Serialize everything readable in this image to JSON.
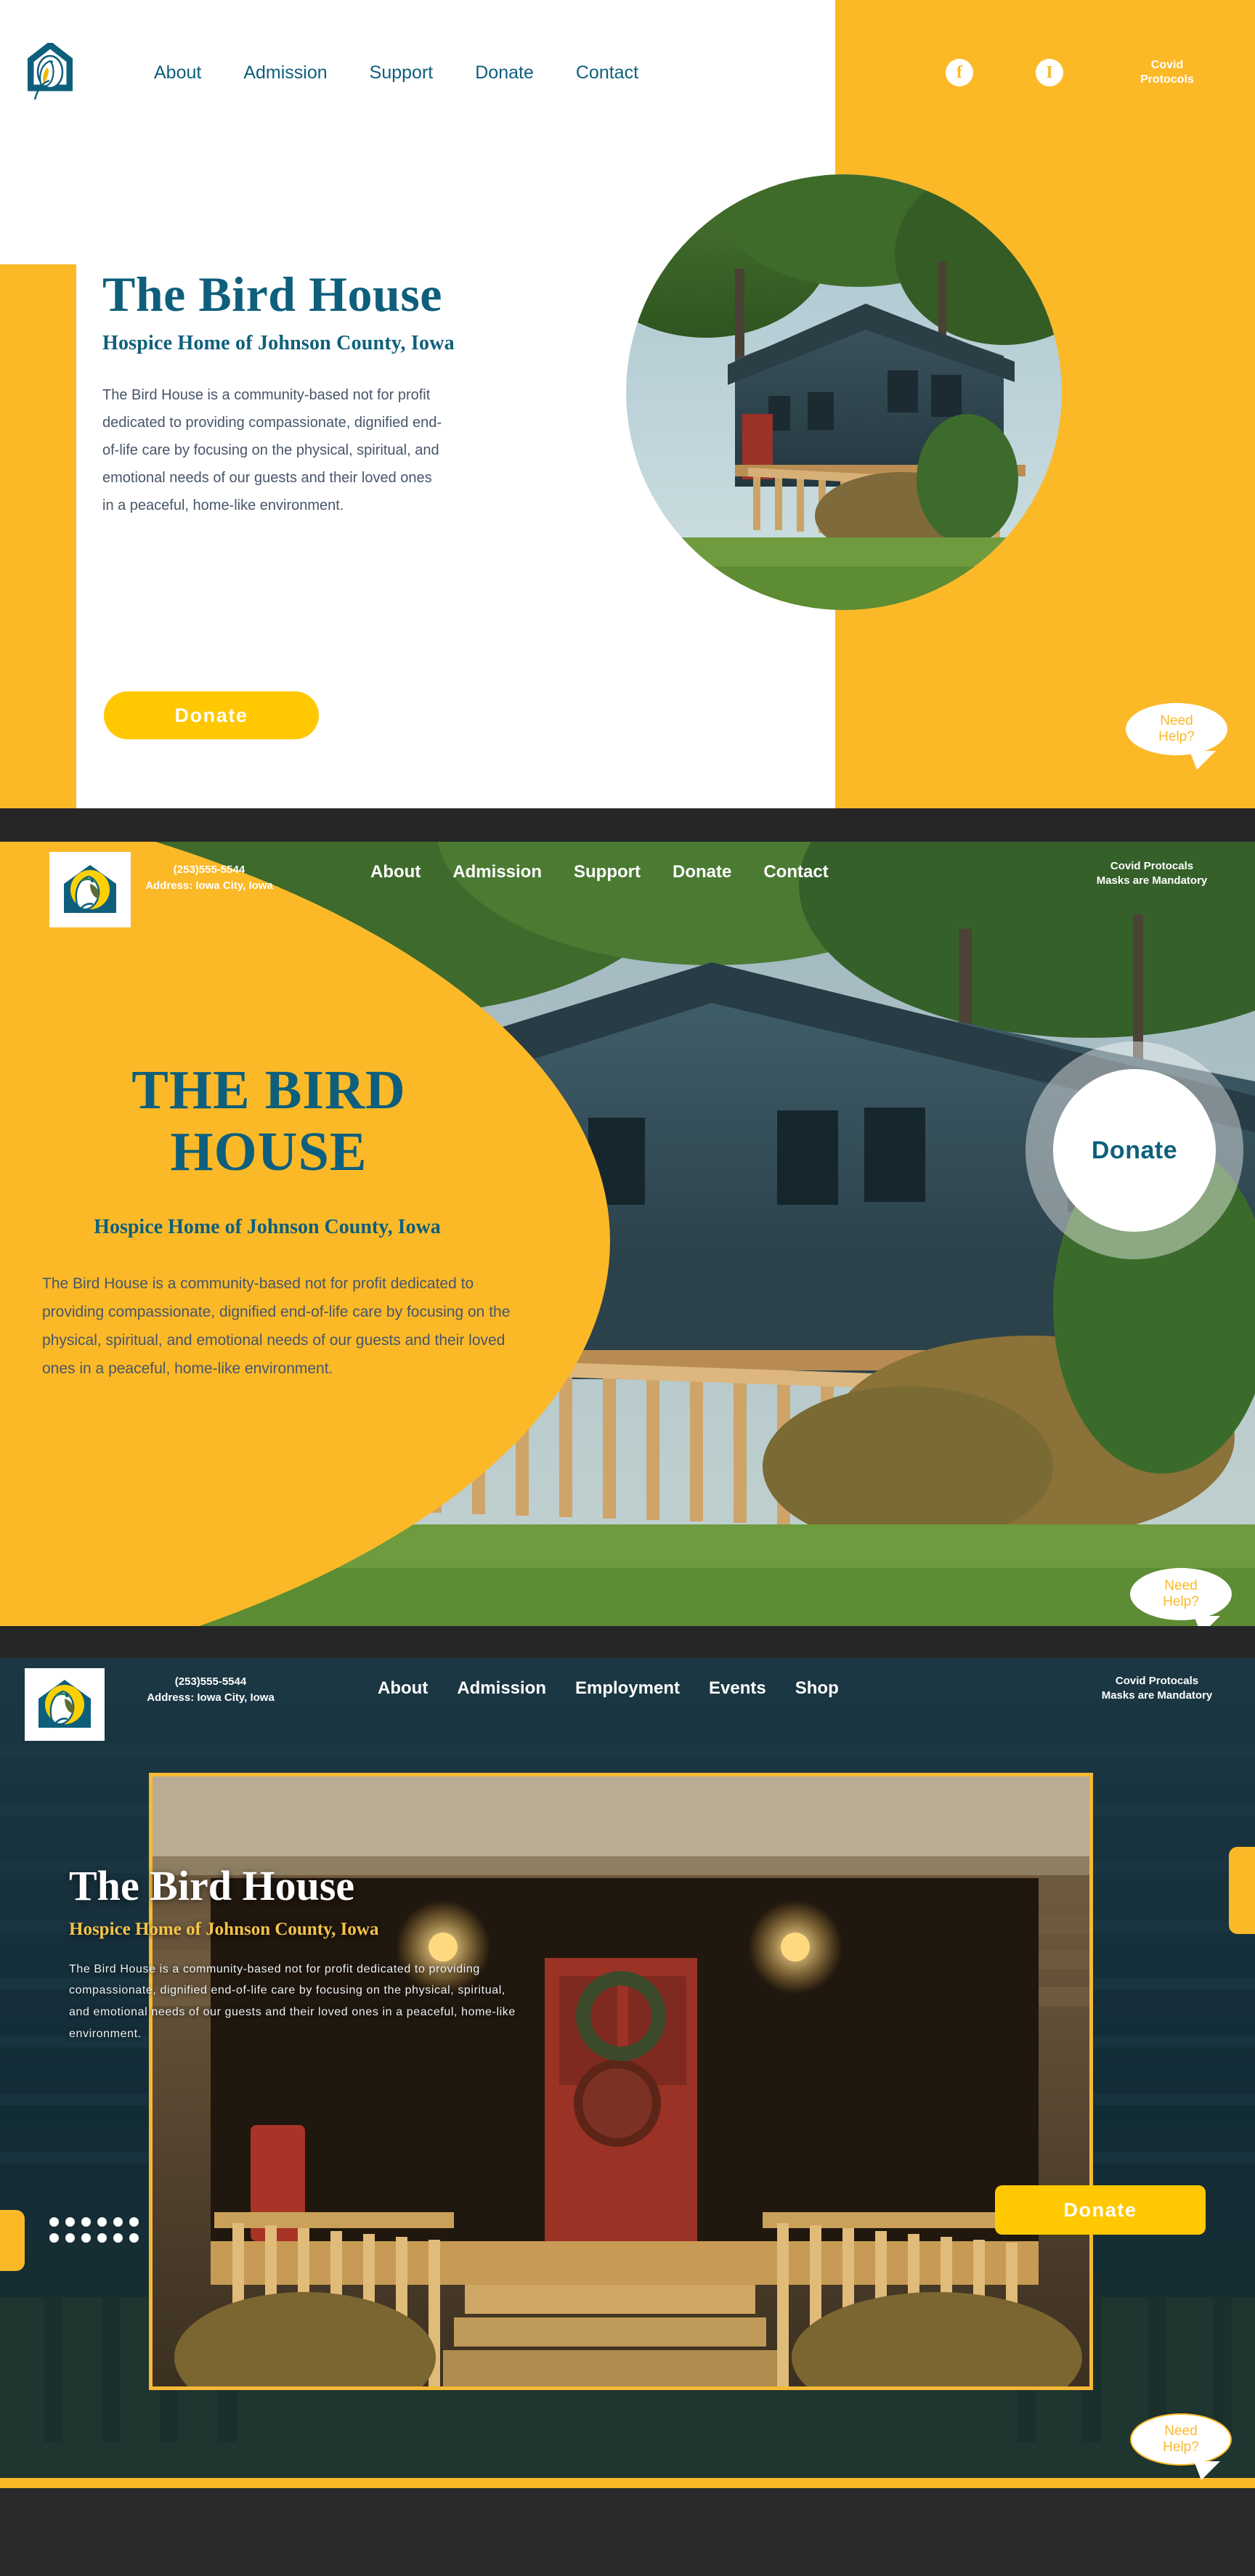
{
  "brand": {
    "name": "The Bird House",
    "tagline": "Hospice Home of Johnson County, Iowa",
    "title_upper_line1": "THE BIRD",
    "title_upper_line2": "HOUSE",
    "description_short": "The Bird House is a community-based not for profit dedicated to providing compassionate, dignified end-of-life care by focusing on the physical, spiritual, and emotional needs of our guests and their loved ones in a peaceful, home-like environment.",
    "colors": {
      "teal": "#0e5f7c",
      "yellow": "#fbb928",
      "donate_yellow": "#ffc800",
      "body_text": "#47566a",
      "dark_gap": "#262626",
      "subtitle_gold": "#f5c349"
    }
  },
  "variant1": {
    "nav": [
      {
        "label": "About"
      },
      {
        "label": "Admission"
      },
      {
        "label": "Support"
      },
      {
        "label": "Donate"
      },
      {
        "label": "Contact"
      }
    ],
    "social": [
      {
        "name": "facebook-icon",
        "glyph": "f"
      },
      {
        "name": "instagram-icon",
        "glyph": "I"
      }
    ],
    "covid_line1": "Covid",
    "covid_line2": "Protocols",
    "heading": "The Bird House",
    "subheading": "Hospice Home of Johnson County, Iowa",
    "paragraph": "The Bird House is a community-based not for profit dedicated to providing compassionate, dignified end-of-life care by focusing on the physical, spiritual, and emotional needs of our guests and their loved ones in a peaceful, home-like environment.",
    "donate_label": "Donate",
    "need_help_line1": "Need",
    "need_help_line2": "Help?"
  },
  "variant2": {
    "phone": "(253)555-5544",
    "address": "Address: Iowa City, Iowa",
    "nav": [
      {
        "label": "About"
      },
      {
        "label": "Admission"
      },
      {
        "label": "Support"
      },
      {
        "label": "Donate"
      },
      {
        "label": "Contact"
      }
    ],
    "covid_line1": "Covid Protocals",
    "covid_line2": "Masks are Mandatory",
    "donate_label": "Donate",
    "title_line1": "THE BIRD",
    "title_line2": "HOUSE",
    "subheading": "Hospice Home of Johnson County, Iowa",
    "paragraph": "The Bird House is a community-based not for profit dedicated to providing compassionate, dignified end-of-life care by focusing on the physical, spiritual, and emotional needs of our guests and their loved ones in a peaceful, home-like environment.",
    "need_help_line1": "Need",
    "need_help_line2": "Help?"
  },
  "variant3": {
    "phone": "(253)555-5544",
    "address": "Address: Iowa City, Iowa",
    "nav": [
      {
        "label": "About"
      },
      {
        "label": "Admission"
      },
      {
        "label": "Employment"
      },
      {
        "label": "Events"
      },
      {
        "label": "Shop"
      }
    ],
    "covid_line1": "Covid Protocals",
    "covid_line2": "Masks are Mandatory",
    "heading": "The Bird House",
    "subheading": "Hospice Home of Johnson County, Iowa",
    "paragraph": "The Bird House is a community-based not for profit dedicated to providing compassionate, dignified end-of-life care by focusing on the physical, spiritual, and emotional needs of our guests and their loved ones in a peaceful, home-like environment.",
    "donate_label": "Donate",
    "need_help_line1": "Need",
    "need_help_line2": "Help?",
    "carousel_dots": 12
  }
}
